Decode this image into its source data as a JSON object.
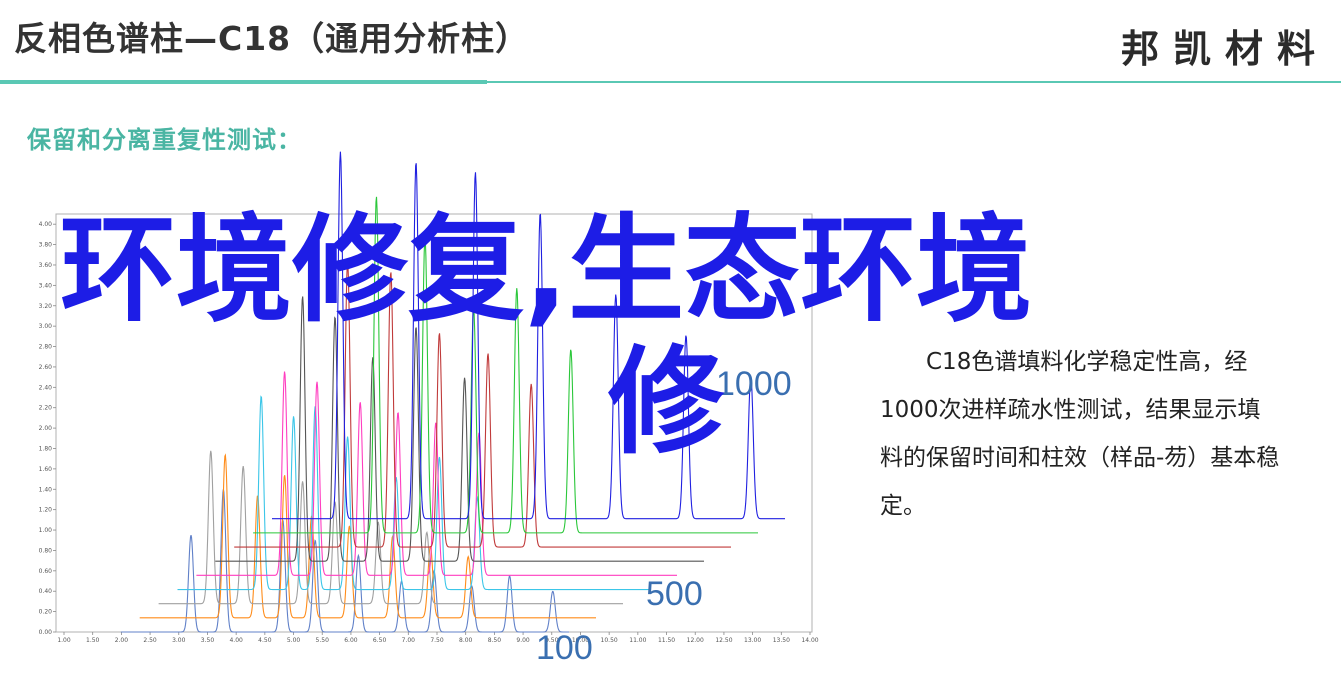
{
  "header": {
    "title": "反相色谱柱—C18（通用分析柱）",
    "brand": "邦凯材料"
  },
  "section": {
    "title": "保留和分离重复性测试："
  },
  "description": "C18色谱填料化学稳定性高，经1000次进样疏水性测试，结果显示填料的保留时间和柱效（样品-芴）基本稳定。",
  "overlay": {
    "line1": "环境修复,生态环境",
    "line2": "修"
  },
  "colors": {
    "accent": "#5ac8b4",
    "section_title": "#4ab5a3",
    "overlay_text": "#1d1de6",
    "series_label": "#3a6fb0"
  },
  "chart_data": {
    "type": "line",
    "title": "",
    "xlabel": "",
    "ylabel": "",
    "xlim": [
      0,
      14
    ],
    "ylim": [
      0,
      4.1
    ],
    "x_ticks": [
      "1.00",
      "1.50",
      "2.00",
      "2.50",
      "3.00",
      "3.50",
      "4.00",
      "4.50",
      "5.00",
      "5.50",
      "6.00",
      "6.50",
      "7.00",
      "7.50",
      "8.00",
      "8.50",
      "9.00",
      "9.50",
      "10.00",
      "10.50",
      "11.00",
      "11.50",
      "12.00",
      "12.50",
      "13.00",
      "13.50",
      "14.00"
    ],
    "y_ticks": [
      "0.00",
      "0.20",
      "0.40",
      "0.60",
      "0.80",
      "1.00",
      "1.20",
      "1.40",
      "1.60",
      "1.80",
      "2.00",
      "2.20",
      "2.40",
      "2.60",
      "2.80",
      "3.00",
      "3.20",
      "3.40",
      "3.60",
      "3.80",
      "4.00"
    ],
    "annotations": [
      "1000",
      "500",
      "100"
    ],
    "series": [
      {
        "color": "#6080c8",
        "peaks": [
          {
            "x": 2.5,
            "h": 0.95
          },
          {
            "x": 3.1,
            "h": 1.4
          },
          {
            "x": 4.2,
            "h": 1.1
          },
          {
            "x": 4.8,
            "h": 0.9
          },
          {
            "x": 5.6,
            "h": 0.75
          },
          {
            "x": 6.4,
            "h": 0.5
          },
          {
            "x": 7.0,
            "h": 0.6
          },
          {
            "x": 7.7,
            "h": 0.45
          },
          {
            "x": 8.4,
            "h": 0.55
          },
          {
            "x": 9.2,
            "h": 0.4
          }
        ]
      },
      {
        "color": "#ff8c1a",
        "peaks": [
          {
            "x": 3.0,
            "h": 1.6
          },
          {
            "x": 3.6,
            "h": 1.2
          },
          {
            "x": 4.1,
            "h": 1.4
          },
          {
            "x": 4.6,
            "h": 1.0
          },
          {
            "x": 5.3,
            "h": 0.9
          },
          {
            "x": 6.1,
            "h": 0.8
          },
          {
            "x": 6.8,
            "h": 0.7
          },
          {
            "x": 7.5,
            "h": 0.6
          }
        ]
      },
      {
        "color": "#a0a0a0",
        "peaks": [
          {
            "x": 2.6,
            "h": 1.5
          },
          {
            "x": 3.2,
            "h": 1.35
          },
          {
            "x": 4.3,
            "h": 1.2
          },
          {
            "x": 4.9,
            "h": 1.0
          },
          {
            "x": 5.7,
            "h": 0.8
          },
          {
            "x": 6.6,
            "h": 0.7
          }
        ]
      },
      {
        "color": "#3bc6e8",
        "peaks": [
          {
            "x": 3.4,
            "h": 1.9
          },
          {
            "x": 4.0,
            "h": 1.7
          },
          {
            "x": 4.4,
            "h": 1.8
          },
          {
            "x": 5.0,
            "h": 1.5
          },
          {
            "x": 5.9,
            "h": 1.1
          },
          {
            "x": 6.7,
            "h": 1.3
          },
          {
            "x": 7.4,
            "h": 0.9
          }
        ]
      },
      {
        "color": "#ff3ec0",
        "peaks": [
          {
            "x": 3.7,
            "h": 2.0
          },
          {
            "x": 4.3,
            "h": 1.9
          },
          {
            "x": 5.1,
            "h": 1.7
          },
          {
            "x": 5.8,
            "h": 1.6
          },
          {
            "x": 6.5,
            "h": 1.5
          },
          {
            "x": 7.3,
            "h": 1.4
          }
        ]
      },
      {
        "color": "#555555",
        "peaks": [
          {
            "x": 3.9,
            "h": 2.6
          },
          {
            "x": 4.5,
            "h": 2.4
          },
          {
            "x": 5.2,
            "h": 2.0
          },
          {
            "x": 6.0,
            "h": 2.3
          },
          {
            "x": 6.9,
            "h": 1.8
          }
        ]
      },
      {
        "color": "#c03a3a",
        "peaks": [
          {
            "x": 4.6,
            "h": 2.8
          },
          {
            "x": 5.4,
            "h": 2.7
          },
          {
            "x": 6.3,
            "h": 2.1
          },
          {
            "x": 7.2,
            "h": 1.9
          },
          {
            "x": 8.0,
            "h": 1.6
          }
        ]
      },
      {
        "color": "#2bc73a",
        "peaks": [
          {
            "x": 5.0,
            "h": 3.3
          },
          {
            "x": 5.9,
            "h": 2.9
          },
          {
            "x": 6.8,
            "h": 2.2
          },
          {
            "x": 7.6,
            "h": 2.4
          },
          {
            "x": 8.6,
            "h": 1.8
          }
        ]
      },
      {
        "color": "#2020e0",
        "peaks": [
          {
            "x": 4.2,
            "h": 3.6
          },
          {
            "x": 5.6,
            "h": 3.5
          },
          {
            "x": 6.7,
            "h": 3.4
          },
          {
            "x": 7.9,
            "h": 3.0
          },
          {
            "x": 9.3,
            "h": 2.2
          },
          {
            "x": 10.6,
            "h": 1.8
          },
          {
            "x": 11.8,
            "h": 1.4
          }
        ]
      }
    ]
  }
}
